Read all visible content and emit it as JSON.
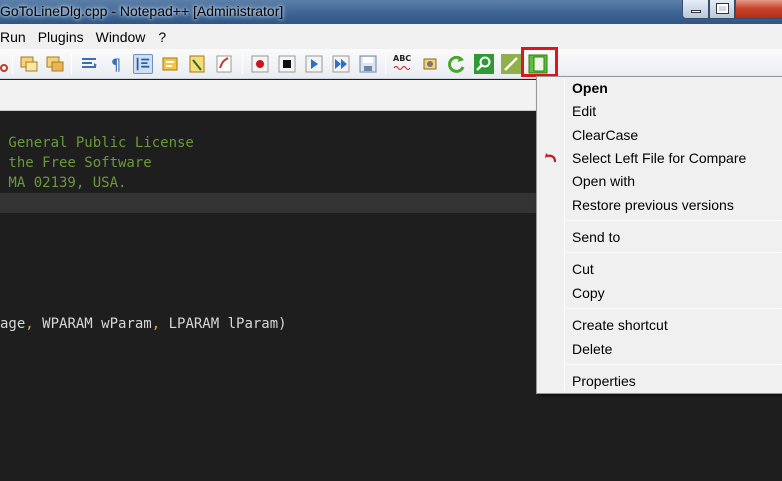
{
  "window": {
    "title": "GoToLineDlg.cpp - Notepad++ [Administrator]"
  },
  "menubar": {
    "items": [
      "Run",
      "Plugins",
      "Window",
      "?"
    ]
  },
  "toolbar": {
    "spellcheck_label": "ABC"
  },
  "editor": {
    "lines": [
      " General Public License",
      " the Free Software",
      " MA 02139, USA."
    ],
    "code_parts": [
      "age",
      ", ",
      "WPARAM wParam",
      ", ",
      "LPARAM lParam",
      ")"
    ]
  },
  "context_menu": {
    "items": [
      {
        "label": "Open"
      },
      {
        "label": "Edit"
      },
      {
        "label": "ClearCase"
      },
      {
        "label": "Select Left File for Compare"
      },
      {
        "label": "Open with"
      },
      {
        "label": "Restore previous versions"
      },
      {
        "label": "Send to"
      },
      {
        "label": "Cut"
      },
      {
        "label": "Copy"
      },
      {
        "label": "Create shortcut"
      },
      {
        "label": "Delete"
      },
      {
        "label": "Properties"
      }
    ]
  },
  "colors": {
    "comment": "#6a9a3b",
    "punctuation": "#e5a82a",
    "highlight": "#e0141c"
  }
}
